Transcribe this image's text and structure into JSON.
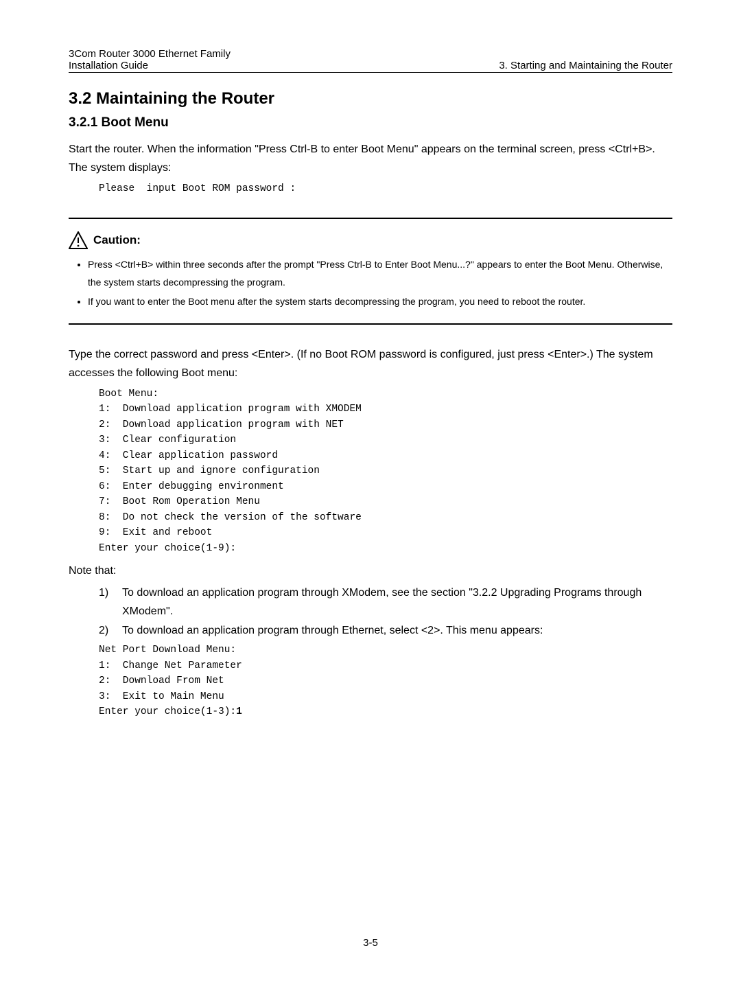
{
  "header": {
    "line1": "3Com Router 3000 Ethernet Family",
    "line2": "Installation Guide",
    "right": "3. Starting and Maintaining the Router"
  },
  "section": {
    "title": "3.2  Maintaining the Router",
    "sub_title": "3.2.1  Boot Menu",
    "intro": "Start the router. When the information \"Press Ctrl-B to enter Boot Menu\" appears on the terminal screen, press <Ctrl+B>. The system displays:",
    "prompt1": "Please  input Boot ROM password :"
  },
  "caution": {
    "label": "Caution:",
    "items": [
      "Press <Ctrl+B> within three seconds after the prompt \"Press Ctrl-B to Enter Boot Menu...?\" appears to enter the Boot Menu. Otherwise, the system starts decompressing the program.",
      "If you want to enter the Boot menu after the system starts decompressing the program, you need to reboot the router."
    ]
  },
  "after_caution": {
    "para": "Type the correct password and press <Enter>. (If no Boot ROM password is configured, just press <Enter>.) The system accesses the following Boot menu:",
    "boot_menu": "Boot Menu:\n1:  Download application program with XMODEM\n2:  Download application program with NET\n3:  Clear configuration\n4:  Clear application password\n5:  Start up and ignore configuration\n6:  Enter debugging environment\n7:  Boot Rom Operation Menu\n8:  Do not check the version of the software\n9:  Exit and reboot\nEnter your choice(1-9):",
    "note_label": "Note that:",
    "notes": [
      {
        "num": "1)",
        "text": "To download an application program through XModem, see the section \"3.2.2  Upgrading Programs through XModem\"."
      },
      {
        "num": "2)",
        "text": "To download an application program through Ethernet, select <2>. This menu appears:"
      }
    ],
    "net_menu": "Net Port Download Menu:\n1:  Change Net Parameter\n2:  Download From Net\n3:  Exit to Main Menu\nEnter your choice(1-3):",
    "net_menu_bold": "1"
  },
  "page_number": "3-5"
}
